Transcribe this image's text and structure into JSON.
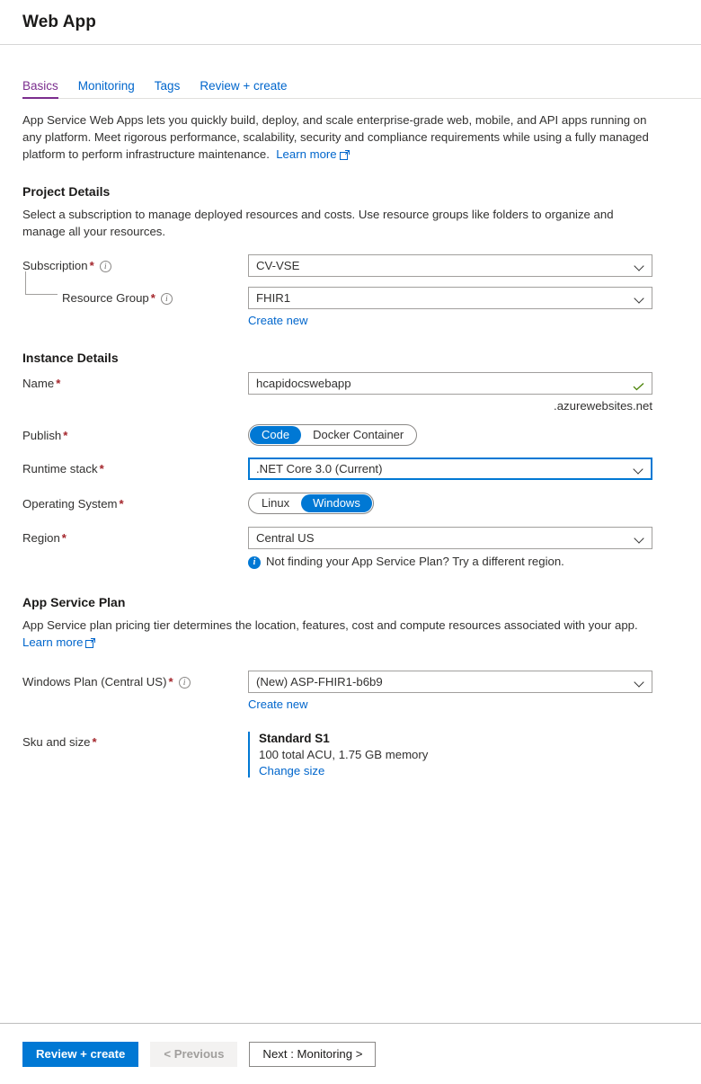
{
  "header": {
    "title": "Web App"
  },
  "tabs": [
    {
      "label": "Basics",
      "active": true
    },
    {
      "label": "Monitoring",
      "active": false
    },
    {
      "label": "Tags",
      "active": false
    },
    {
      "label": "Review + create",
      "active": false
    }
  ],
  "intro": {
    "text": "App Service Web Apps lets you quickly build, deploy, and scale enterprise-grade web, mobile, and API apps running on any platform. Meet rigorous performance, scalability, security and compliance requirements while using a fully managed platform to perform infrastructure maintenance.",
    "learn_more": "Learn more",
    "external_icon": "external-link-icon"
  },
  "project_details": {
    "heading": "Project Details",
    "description": "Select a subscription to manage deployed resources and costs. Use resource groups like folders to organize and manage all your resources.",
    "subscription": {
      "label": "Subscription",
      "required": "*",
      "info_icon": "info-icon",
      "value": "CV-VSE"
    },
    "resource_group": {
      "label": "Resource Group",
      "required": "*",
      "info_icon": "info-icon",
      "value": "FHIR1",
      "create_new": "Create new"
    }
  },
  "instance_details": {
    "heading": "Instance Details",
    "name": {
      "label": "Name",
      "required": "*",
      "value": "hcapidocswebapp",
      "suffix": ".azurewebsites.net",
      "valid_icon": "checkmark-icon"
    },
    "publish": {
      "label": "Publish",
      "required": "*",
      "options": [
        {
          "label": "Code",
          "selected": true
        },
        {
          "label": "Docker Container",
          "selected": false
        }
      ]
    },
    "runtime_stack": {
      "label": "Runtime stack",
      "required": "*",
      "value": ".NET Core 3.0 (Current)",
      "focused": true
    },
    "operating_system": {
      "label": "Operating System",
      "required": "*",
      "options": [
        {
          "label": "Linux",
          "selected": false
        },
        {
          "label": "Windows",
          "selected": true
        }
      ]
    },
    "region": {
      "label": "Region",
      "required": "*",
      "value": "Central US",
      "notice": "Not finding your App Service Plan? Try a different region.",
      "notice_icon": "info-filled-icon"
    }
  },
  "app_service_plan": {
    "heading": "App Service Plan",
    "description": "App Service plan pricing tier determines the location, features, cost and compute resources associated with your app.",
    "learn_more": "Learn more",
    "plan": {
      "label": "Windows Plan (Central US)",
      "required": "*",
      "info_icon": "info-icon",
      "value": "(New) ASP-FHIR1-b6b9",
      "create_new": "Create new"
    },
    "sku": {
      "label": "Sku and size",
      "required": "*",
      "title": "Standard S1",
      "description": "100 total ACU, 1.75 GB memory",
      "change_link": "Change size"
    }
  },
  "footer": {
    "review_create": "Review + create",
    "previous": "< Previous",
    "next": "Next : Monitoring >"
  },
  "colors": {
    "accent_blue": "#0078d4",
    "link_blue": "#0066cc",
    "active_tab_purple": "#7b2d8e",
    "required_red": "#a4262c",
    "valid_green": "#498205"
  }
}
